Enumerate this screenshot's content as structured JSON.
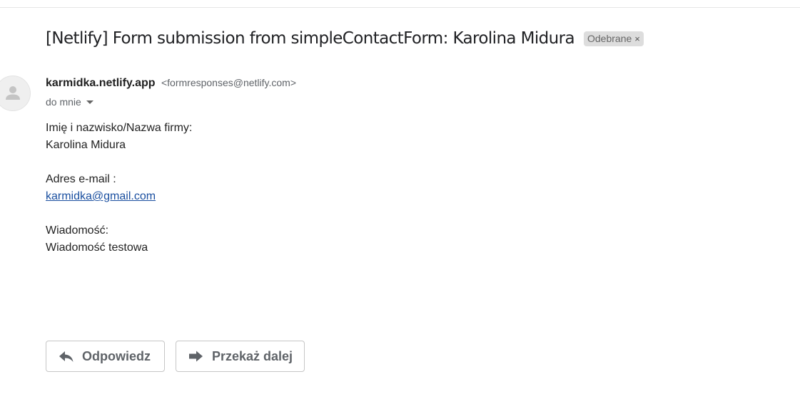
{
  "email": {
    "subject": "[Netlify] Form submission from simpleContactForm: Karolina Midura",
    "label": "Odebrane",
    "label_remove": "×",
    "sender_name": "karmidka.netlify.app",
    "sender_email": "<formresponses@netlify.com>",
    "recipient": "do mnie"
  },
  "body": {
    "field1_label": "Imię i nazwisko/Nazwa firmy:",
    "field1_value": "Karolina Midura",
    "field2_label": "Adres e-mail :",
    "field2_value": "karmidka@gmail.com",
    "field3_label": "Wiadomość:",
    "field3_value": "Wiadomość testowa"
  },
  "actions": {
    "reply_label": "Odpowiedz",
    "forward_label": "Przekaż dalej"
  },
  "icons": {
    "avatar": "person-icon",
    "recipient_caret": "caret-down-icon",
    "reply": "reply-icon",
    "forward": "forward-icon"
  }
}
